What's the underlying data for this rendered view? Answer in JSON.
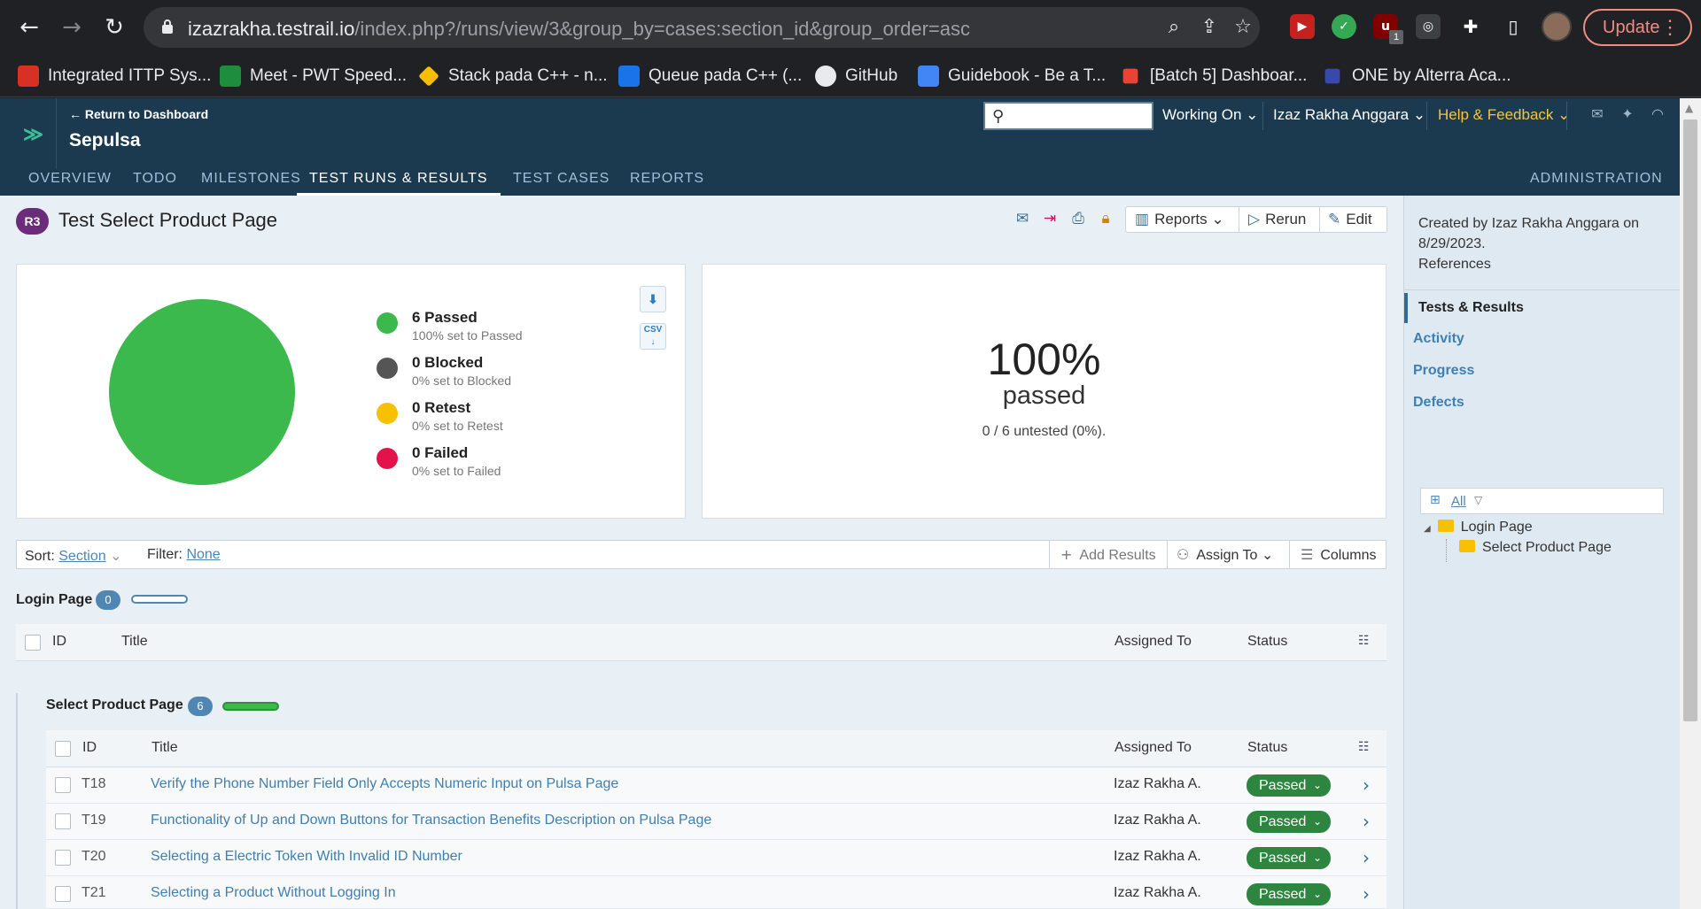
{
  "browser": {
    "url_host": "izazrakha.testrail.io",
    "url_path": "/index.php?/runs/view/3&group_by=cases:section_id&group_order=asc",
    "update_label": "Update",
    "ext_badge": "1",
    "bookmarks": [
      "Integrated ITTP Sys...",
      "Meet - PWT Speed...",
      "Stack pada C++ - n...",
      "Queue pada C++ (...",
      "GitHub",
      "Guidebook - Be a T...",
      "[Batch 5] Dashboar...",
      "ONE by Alterra Aca..."
    ]
  },
  "header": {
    "return_link": "← Return to Dashboard",
    "project": "Sepulsa",
    "search_placeholder": "",
    "working_on": "Working On",
    "user": "Izaz Rakha Anggara",
    "help": "Help & Feedback",
    "tabs": [
      "OVERVIEW",
      "TODO",
      "MILESTONES",
      "TEST RUNS & RESULTS",
      "TEST CASES",
      "REPORTS"
    ],
    "admin": "ADMINISTRATION"
  },
  "run": {
    "badge": "R3",
    "title": "Test Select Product Page",
    "reports_label": "Reports",
    "rerun_label": "Rerun",
    "edit_label": "Edit"
  },
  "stats": {
    "legend": [
      {
        "label": "6 Passed",
        "sub": "100% set to Passed",
        "color": "#3cb94c"
      },
      {
        "label": "0 Blocked",
        "sub": "0% set to Blocked",
        "color": "#555555"
      },
      {
        "label": "0 Retest",
        "sub": "0% set to Retest",
        "color": "#f7c000"
      },
      {
        "label": "0 Failed",
        "sub": "0% set to Failed",
        "color": "#e4124b"
      }
    ],
    "csv_label": "CSV",
    "percent": "100%",
    "percent_label": "passed",
    "untested": "0 / 6 untested (0%)."
  },
  "sortbar": {
    "sort_label": "Sort:",
    "sort_value": "Section",
    "filter_label": "Filter:",
    "filter_value": "None",
    "add_results": "Add Results",
    "assign_to": "Assign To",
    "columns": "Columns"
  },
  "table_headers": {
    "id": "ID",
    "title": "Title",
    "assigned": "Assigned To",
    "status": "Status"
  },
  "sections": [
    {
      "name": "Login Page",
      "count": "0",
      "progress": 0
    },
    {
      "name": "Select Product Page",
      "count": "6",
      "progress": 1
    }
  ],
  "rows": [
    {
      "id": "T18",
      "title": "Verify the Phone Number Field Only Accepts Numeric Input on Pulsa Page",
      "assigned": "Izaz Rakha A.",
      "status": "Passed"
    },
    {
      "id": "T19",
      "title": "Functionality of Up and Down Buttons for Transaction Benefits Description on Pulsa Page",
      "assigned": "Izaz Rakha A.",
      "status": "Passed"
    },
    {
      "id": "T20",
      "title": "Selecting a Electric Token With Invalid ID Number",
      "assigned": "Izaz Rakha A.",
      "status": "Passed"
    },
    {
      "id": "T21",
      "title": "Selecting a Product Without Logging In",
      "assigned": "Izaz Rakha A.",
      "status": "Passed"
    }
  ],
  "sidebar": {
    "created": "Created by Izaz Rakha Anggara on 8/29/2023.",
    "references": "References",
    "links": [
      "Tests & Results",
      "Activity",
      "Progress",
      "Defects"
    ],
    "tree_filter": "All",
    "tree": [
      "Login Page",
      "Select Product Page"
    ]
  },
  "colors": {
    "header": "#1b3a4f",
    "passed": "#3cb94c",
    "accent": "#4f86b4"
  }
}
